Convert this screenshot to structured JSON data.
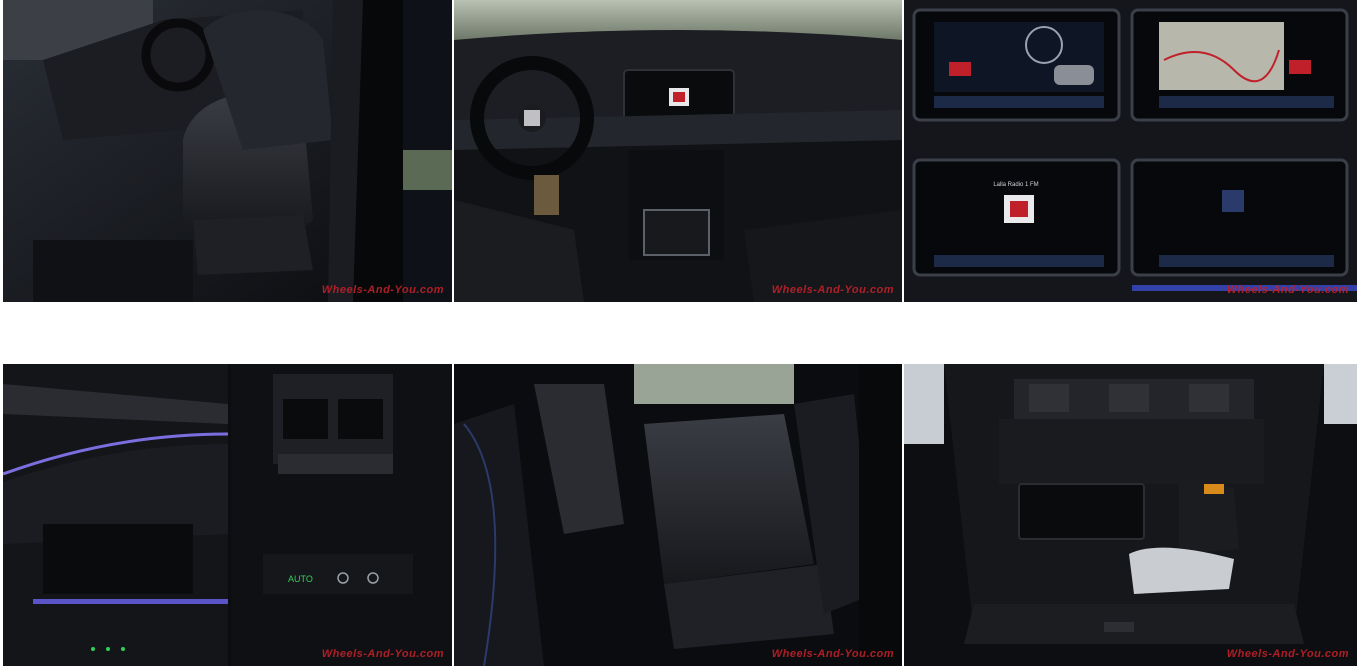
{
  "gallery": {
    "watermark": "Wheels-And-You.com",
    "screen_texts": {
      "radio_title": "Lalla Radio 1 FM",
      "auto_label": "AUTO"
    }
  }
}
